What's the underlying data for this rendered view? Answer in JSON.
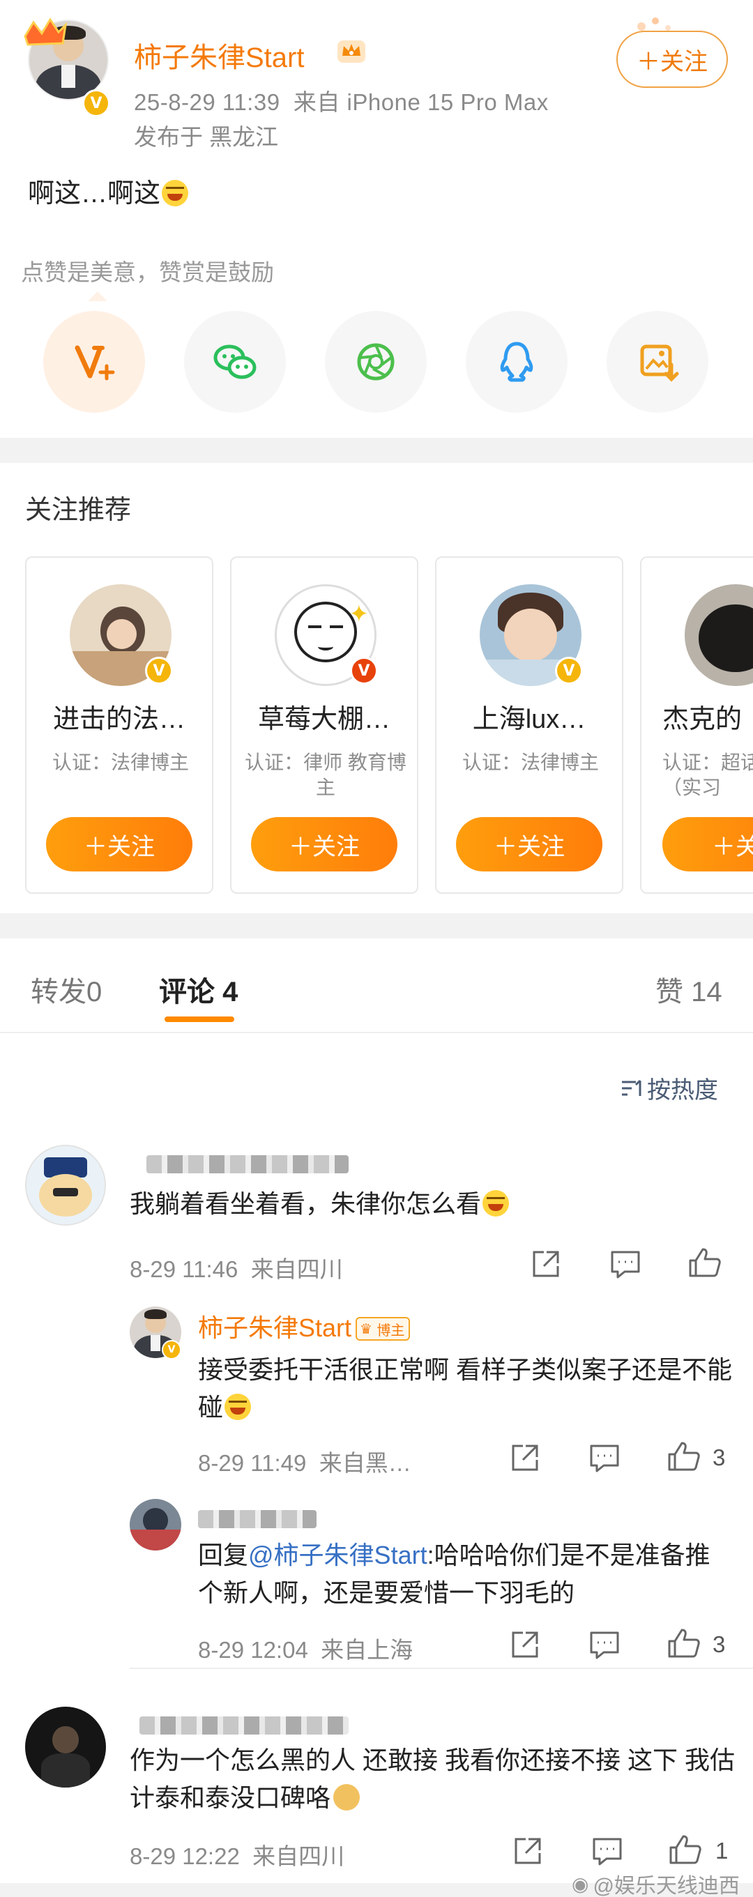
{
  "post": {
    "username": "柿子朱律Start",
    "meta_time": "25-8-29 11:39",
    "meta_source": "来自 iPhone 15 Pro Max",
    "location": "发布于 黑龙江",
    "follow_label": "＋关注",
    "text": "啊这…啊这",
    "reward_tip": "点赞是美意，赞赏是鼓励",
    "share_icons": [
      "reward-v-icon",
      "wechat-icon",
      "moments-icon",
      "qq-icon",
      "save-image-icon"
    ]
  },
  "recommend": {
    "title": "关注推荐",
    "items": [
      {
        "name": "进击的法…",
        "cert": "认证：法律博主",
        "btn": "＋关注"
      },
      {
        "name": "草莓大棚…",
        "cert": "认证：律师 教育博主",
        "btn": "＋关注"
      },
      {
        "name": "上海lux…",
        "cert": "认证：法律博主",
        "btn": "＋关注"
      },
      {
        "name": "杰克的",
        "cert": "认证：超话持人（实习",
        "btn": "＋关"
      }
    ]
  },
  "tabs": {
    "repost": "转发",
    "repost_count": "0",
    "comment": "评论",
    "comment_count": "4",
    "like": "赞",
    "like_count": "14"
  },
  "sort_label": "按热度",
  "comments": [
    {
      "text": "我躺着看坐着看，朱律你怎么看",
      "time": "8-29 11:46",
      "source": "来自四川",
      "likes": ""
    },
    {
      "name": "柿子朱律Start",
      "tag": "博主",
      "text": "接受委托干活很正常啊 看样子类似案子还是不能碰",
      "time": "8-29 11:49",
      "source": "来自黑…",
      "likes": "3"
    },
    {
      "reply_prefix": "回复",
      "mention": "@柿子朱律Start",
      "text": ":哈哈哈你们是不是准备推个新人啊，还是要爱惜一下羽毛的",
      "time": "8-29 12:04",
      "source": "来自上海",
      "likes": "3"
    },
    {
      "text": "作为一个怎么黑的人 还敢接  我看你还接不接 这下 我估计泰和泰没口碑咯",
      "time": "8-29 12:22",
      "source": "来自四川",
      "likes": "1"
    }
  ],
  "watermark": "@娱乐天线迪西",
  "colors": {
    "accent": "#f47a09",
    "button": "#ff8a00",
    "link": "#3770c4"
  }
}
